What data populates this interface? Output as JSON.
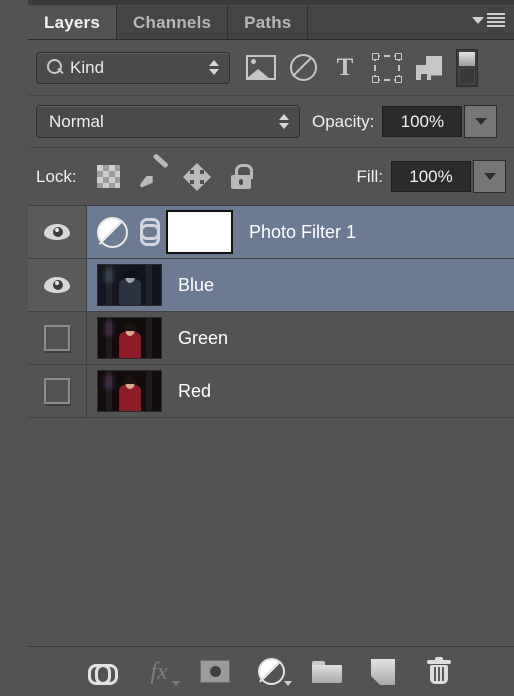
{
  "panel": {
    "tabs": [
      {
        "label": "Layers",
        "active": true
      },
      {
        "label": "Channels",
        "active": false
      },
      {
        "label": "Paths",
        "active": false
      }
    ],
    "menu_icon": "panel-menu-icon"
  },
  "filter": {
    "search_icon": "magnifier-icon",
    "kind_value": "Kind",
    "stepper_icon": "updown-stepper-icon",
    "type_filters": [
      {
        "name": "filter-pixel-layers-icon",
        "title": "Pixel Layers"
      },
      {
        "name": "filter-adjustment-layers-icon",
        "title": "Adjustment Layers"
      },
      {
        "name": "filter-type-layers-icon",
        "title": "Type Layers"
      },
      {
        "name": "filter-shape-layers-icon",
        "title": "Shape Layers"
      },
      {
        "name": "filter-smart-objects-icon",
        "title": "Smart Objects"
      }
    ],
    "toggle_icon": "filter-enable-toggle"
  },
  "blend": {
    "mode_value": "Normal",
    "opacity_label": "Opacity:",
    "opacity_value": "100%",
    "opacity_dropdown_icon": "chevron-down-icon"
  },
  "lock": {
    "label": "Lock:",
    "items": [
      {
        "name": "lock-transparent-pixels-icon"
      },
      {
        "name": "lock-image-pixels-icon"
      },
      {
        "name": "lock-position-icon"
      },
      {
        "name": "lock-all-icon"
      }
    ],
    "fill_label": "Fill:",
    "fill_value": "100%",
    "fill_dropdown_icon": "chevron-down-icon"
  },
  "layers": [
    {
      "name": "Photo Filter 1",
      "visible": true,
      "selected": true,
      "kind": "adjustment",
      "has_link": true,
      "has_mask": true
    },
    {
      "name": "Blue",
      "visible": true,
      "selected": true,
      "kind": "pixel",
      "has_link": false,
      "has_mask": false
    },
    {
      "name": "Green",
      "visible": false,
      "selected": false,
      "kind": "pixel",
      "has_link": false,
      "has_mask": false
    },
    {
      "name": "Red",
      "visible": false,
      "selected": false,
      "kind": "pixel",
      "has_link": false,
      "has_mask": false
    }
  ],
  "bottom_bar": [
    {
      "name": "link-layers-icon",
      "enabled": true
    },
    {
      "name": "layer-style-fx-icon",
      "enabled": false
    },
    {
      "name": "add-layer-mask-icon",
      "enabled": true
    },
    {
      "name": "new-adjustment-layer-icon",
      "enabled": true
    },
    {
      "name": "new-group-icon",
      "enabled": true
    },
    {
      "name": "new-layer-icon",
      "enabled": true
    },
    {
      "name": "delete-layer-icon",
      "enabled": true
    }
  ],
  "colors": {
    "panel_bg": "#535353",
    "selection": "#6C7A93",
    "tab_active_bg": "#535353",
    "tab_inactive_bg": "#444444",
    "text": "#F0F0F0",
    "icon": "#C6C6C6"
  }
}
